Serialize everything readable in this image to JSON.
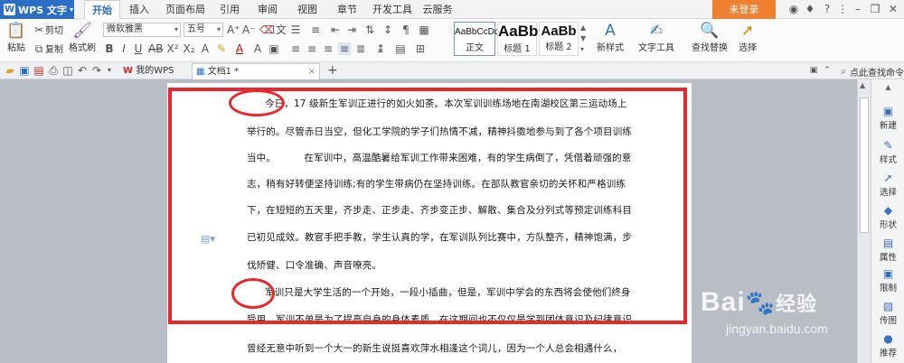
{
  "app": {
    "name": "WPS 文字"
  },
  "menu": {
    "tabs": [
      "开始",
      "插入",
      "页面布局",
      "引用",
      "审阅",
      "视图",
      "章节",
      "开发工具",
      "云服务"
    ],
    "active_index": 0,
    "login_label": "未登录"
  },
  "ribbon": {
    "paste_label": "粘贴",
    "cut_label": "剪切",
    "copy_label": "复制",
    "format_painter_label": "格式刷",
    "font_name": "微软雅黑",
    "font_size": "五号",
    "styles": [
      {
        "sample": "AaBbCcDd",
        "name": "正文"
      },
      {
        "sample": "AaBb",
        "name": "标题 1"
      },
      {
        "sample": "AaBb",
        "name": "标题 2"
      }
    ],
    "new_style_label": "新样式",
    "text_tools_label": "文字工具",
    "find_replace_label": "查找替换",
    "select_label": "选择"
  },
  "quickbar": {
    "tabs": [
      "我的WPS",
      "文档1 *"
    ],
    "search_label": "点此查找命令"
  },
  "document": {
    "lines": [
      "今日，17 级新生军训正进行的如火如荼。本次军训训练场地在南湖校区第三运动场上",
      "举行的。尽管赤日当空，但化工学院的学子们热情不减，精神抖擞地参与到了各个项目训练",
      "当中。         在军训中，高温酷暑给军训工作带来困难，有的学生病倒了，凭借着顽强的意",
      "志，稍有好转便坚持训练;有的学生带病仍在坚持训练。在部队教官亲切的关怀和严格训练",
      "下，在短短的五天里，齐步走、正步走、齐步变正步、解散、集合及分列式等预定训练科目",
      "已初见成效。教官手把手教，学生认真的学，在军训队列比赛中，方队整齐，精神饱满，步",
      "伐矫健、口令准确、声音嘹亮。",
      "军训只是大学生活的一个开始，一段小插曲，但是，军训中学会的东西将会使他们终身",
      "受用。军训不单是为了提高自身的身体素质，在这期间也不仅仅是学到团体意识及纪律意识",
      "曾经无意中听到一个大一的新生说挺喜欢萍水相逢这个词儿，因为一个人总会相遇什么，"
    ]
  },
  "taskpane": {
    "items": [
      "新建",
      "样式",
      "选择",
      "形状",
      "属性",
      "限制",
      "传图",
      "推荐"
    ]
  },
  "watermark": {
    "logo": "Bai",
    "logo2": "经验",
    "url": "jingyan.baidu.com"
  },
  "colors": {
    "accent": "#2b6fc4",
    "annotation": "#e8282c",
    "login": "#f08030"
  }
}
